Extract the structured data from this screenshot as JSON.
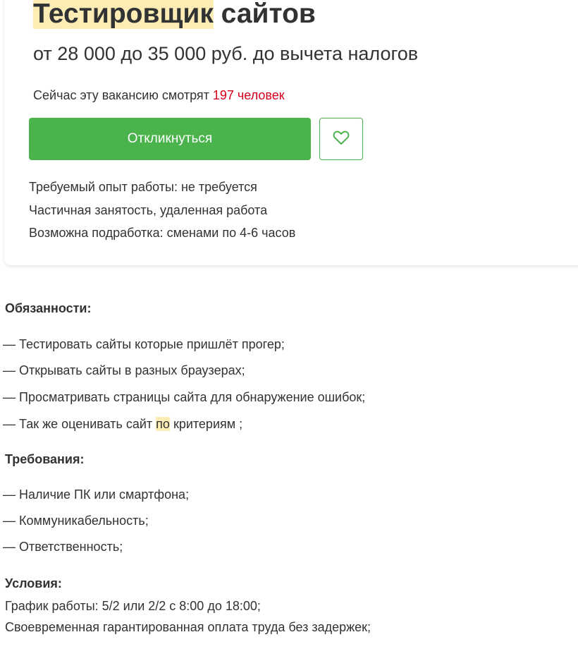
{
  "vacancy": {
    "title_highlight": "Тестировщик",
    "title_rest": " сайтов",
    "salary": "от 28 000 до 35 000 руб. до вычета налогов",
    "viewers_prefix": "Сейчас эту вакансию смотрят ",
    "viewers_count": "197 человек",
    "apply_label": "Откликнуться",
    "favorite_icon": "heart-icon",
    "facts": [
      "Требуемый опыт работы: не требуется",
      "Частичная занятость, удаленная работа",
      "Возможна подработка: сменами по 4-6 часов"
    ]
  },
  "description": {
    "duties_title": "Обязанности:",
    "duties": [
      {
        "text": "— Тестировать сайты которые пришлёт прогер;"
      },
      {
        "text": "— Открывать сайты в разных браузерах;"
      },
      {
        "text": "— Просматривать страницы сайта для обнаружение ошибок;"
      },
      {
        "before": "— Так же оценивать сайт ",
        "highlight": "по",
        "after": " критериям ;"
      }
    ],
    "requirements_title": "Требования:",
    "requirements": [
      "— Наличие ПК или смартфона;",
      "— Коммуникабельность;",
      "— Ответственность;"
    ],
    "conditions_title": "Условия:",
    "conditions": [
      "График работы: 5/2 или 2/2 с 8:00 до 18:00;",
      "Своевременная гарантированная оплата труда без задержек;"
    ]
  },
  "colors": {
    "accent_green": "#4bb34b",
    "highlight": "#fdecb3",
    "viewers_red": "#d6001c",
    "text": "#303233"
  }
}
